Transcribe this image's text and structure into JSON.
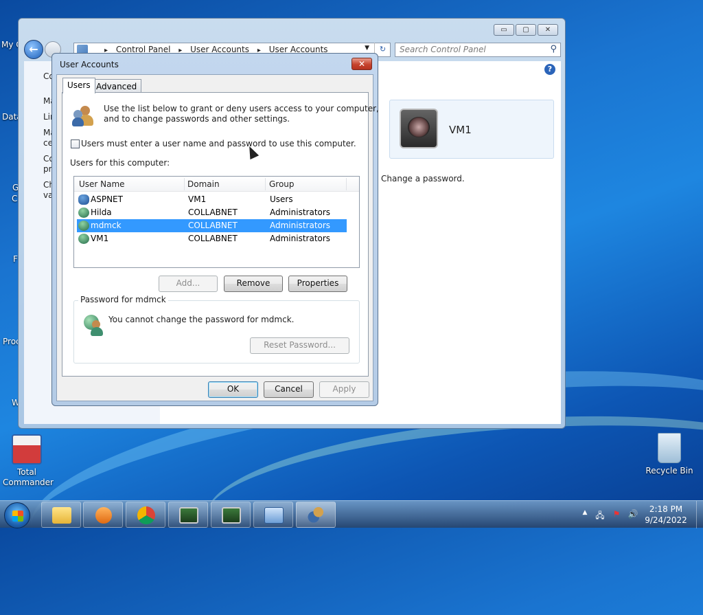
{
  "desktop": {
    "icons": [
      {
        "label": "Total\nCommander"
      },
      {
        "label": "Recycle Bin"
      }
    ],
    "partial_labels": [
      "My C",
      "Data",
      "G",
      "C",
      "F",
      "Proc",
      "W"
    ]
  },
  "control_panel": {
    "breadcrumbs": [
      "Control Panel",
      "User Accounts",
      "User Accounts"
    ],
    "search_placeholder": "Search Control Panel",
    "left_links": [
      "Co",
      "Ma",
      "Lin",
      "Ma",
      "ce",
      "Co",
      "pr",
      "Ch",
      "va"
    ],
    "account_name": "VM1",
    "change_password": "Change a password.",
    "window_buttons": [
      "▭",
      "▢",
      "✕"
    ]
  },
  "dialog": {
    "title": "User Accounts",
    "tabs": [
      "Users",
      "Advanced"
    ],
    "intro_line1": "Use the list below to grant or deny users access to your computer,",
    "intro_line2": "and to change passwords and other settings.",
    "checkbox_label": "Users must enter a user name and password to use this computer.",
    "checkbox_checked": false,
    "users_label": "Users for this computer:",
    "columns": [
      "User Name",
      "Domain",
      "Group"
    ],
    "rows": [
      {
        "name": "ASPNET",
        "domain": "VM1",
        "group": "Users"
      },
      {
        "name": "Hilda",
        "domain": "COLLABNET",
        "group": "Administrators"
      },
      {
        "name": "mdmck",
        "domain": "COLLABNET",
        "group": "Administrators"
      },
      {
        "name": "VM1",
        "domain": "COLLABNET",
        "group": "Administrators"
      }
    ],
    "selected_row": 2,
    "add_button": "Add...",
    "remove_button": "Remove",
    "properties_button": "Properties",
    "password_group_label": "Password for mdmck",
    "password_message": "You cannot change the password for mdmck.",
    "reset_password_button": "Reset Password...",
    "ok_button": "OK",
    "cancel_button": "Cancel",
    "apply_button": "Apply"
  },
  "taskbar": {
    "time": "2:18 PM",
    "date": "9/24/2022"
  }
}
